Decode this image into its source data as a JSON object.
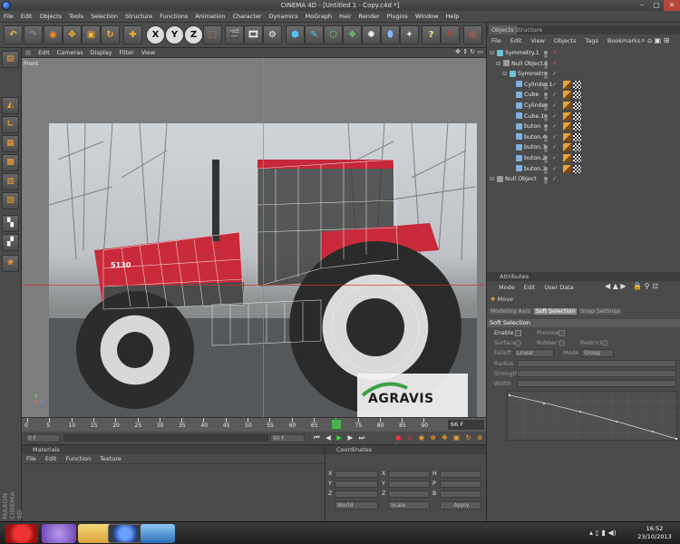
{
  "window": {
    "title": "CINEMA 4D - [Untitled 1 - Copy.c4d *]",
    "minimize": "–",
    "maximize": "▢",
    "close": "✕"
  },
  "menubar": [
    "File",
    "Edit",
    "Objects",
    "Tools",
    "Selection",
    "Structure",
    "Functions",
    "Animation",
    "Character",
    "Dynamics",
    "MoGraph",
    "Hair",
    "Render",
    "Plugins",
    "Window",
    "Help"
  ],
  "toolbar_axes": [
    "X",
    "Y",
    "Z"
  ],
  "viewport": {
    "menu": [
      "Edit",
      "Cameras",
      "Display",
      "Filter",
      "View"
    ],
    "label": "Front",
    "image": {
      "model_badge": "5130",
      "watermark": "AGRAVIS"
    }
  },
  "timeline": {
    "ticks": [
      "0",
      "5",
      "10",
      "15",
      "20",
      "25",
      "30",
      "35",
      "40",
      "45",
      "50",
      "55",
      "60",
      "65",
      "70",
      "75",
      "80",
      "85",
      "90"
    ],
    "end_frame": "66 F",
    "current": "0 F",
    "range_end": "90 F"
  },
  "materials": {
    "title": "Materials",
    "menu": [
      "File",
      "Edit",
      "Function",
      "Texture"
    ]
  },
  "coordinates": {
    "title": "Coordinates",
    "row_labels": [
      "X",
      "Y",
      "Z"
    ],
    "mid_labels": [
      "X",
      "Y",
      "Z"
    ],
    "right_labels": [
      "H",
      "P",
      "B"
    ],
    "world": "World",
    "scale": "Scale",
    "apply": "Apply"
  },
  "objects_panel": {
    "tabs": [
      "Objects",
      "Structure"
    ],
    "menu": [
      "File",
      "Edit",
      "View",
      "Objects",
      "Tags",
      "Bookmarks"
    ],
    "items": [
      {
        "name": "Symmetry.1",
        "indent": 0,
        "color": "#6ec3d6",
        "tags": 0
      },
      {
        "name": "Null Object.1",
        "indent": 1,
        "color": "#9a9a9a",
        "tags": 0
      },
      {
        "name": "Symmetry",
        "indent": 2,
        "color": "#6ec3d6",
        "tags": 0
      },
      {
        "name": "Cylinder.1",
        "indent": 3,
        "color": "#7fb0e0",
        "tags": 2
      },
      {
        "name": "Cube",
        "indent": 3,
        "color": "#7fb0e0",
        "tags": 2
      },
      {
        "name": "Cylinder",
        "indent": 3,
        "color": "#7fb0e0",
        "tags": 2
      },
      {
        "name": "Cube.1",
        "indent": 3,
        "color": "#7fb0e0",
        "tags": 2
      },
      {
        "name": "buton",
        "indent": 3,
        "color": "#7fb0e0",
        "tags": 2
      },
      {
        "name": "buton.4",
        "indent": 3,
        "color": "#7fb0e0",
        "tags": 2
      },
      {
        "name": "buton.1",
        "indent": 3,
        "color": "#7fb0e0",
        "tags": 2
      },
      {
        "name": "buton.2",
        "indent": 3,
        "color": "#7fb0e0",
        "tags": 2
      },
      {
        "name": "buton.3",
        "indent": 3,
        "color": "#7fb0e0",
        "tags": 2
      },
      {
        "name": "Null Object",
        "indent": 0,
        "color": "#9a9a9a",
        "tags": 0
      }
    ]
  },
  "attributes": {
    "title": "Attributes",
    "menu": [
      "Mode",
      "Edit",
      "User Data"
    ],
    "tool": "Move",
    "tabs": [
      "Modeling Axis",
      "Soft Selection",
      "Snap Settings"
    ],
    "section": "Soft Selection",
    "enable": "Enable",
    "preview": "Preview",
    "surface": "Surface",
    "rubber": "Rubber",
    "restrict": "Restrict",
    "falloff": "Falloff",
    "falloff_value": "Linear",
    "mode": "Mode",
    "mode_value": "Group",
    "radius": "Radius",
    "strength": "Strength",
    "width": "Width"
  },
  "taskbar": {
    "time": "16:52",
    "date": "23/10/2013"
  },
  "brand": "MAXON CINEMA 4D"
}
